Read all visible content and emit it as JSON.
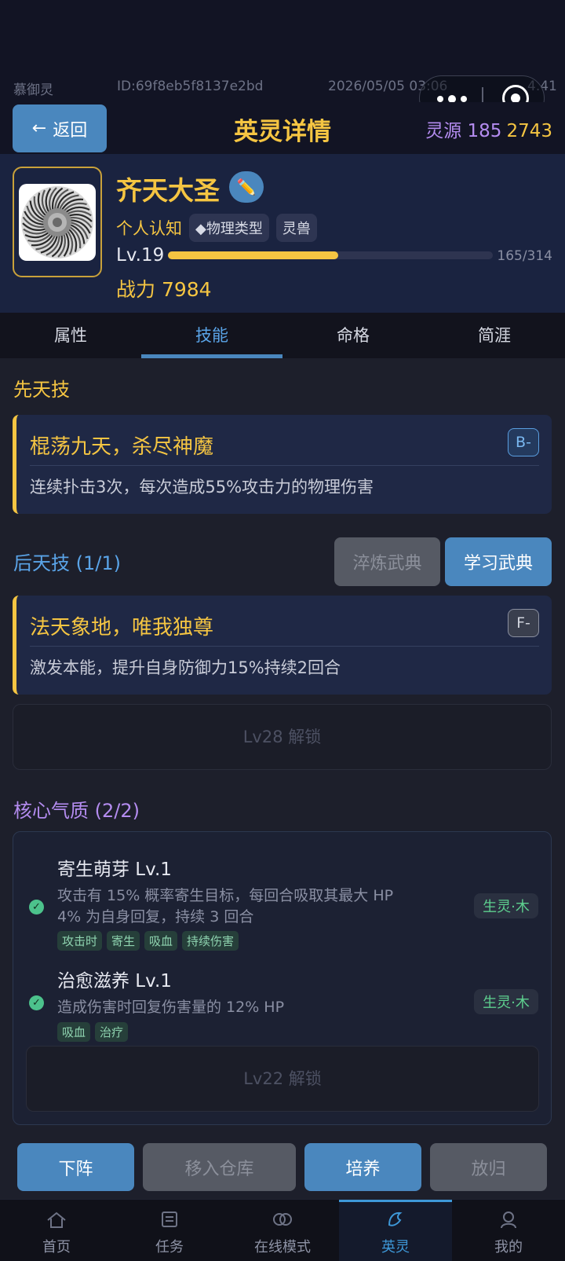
{
  "status": {
    "app_name": "慕御灵",
    "id_text": "ID:69f8eb5f8137e2bd",
    "datetime": "2026/05/05 03:06",
    "extra": "4.41"
  },
  "header": {
    "back_label": "返回",
    "title": "英灵详情",
    "currency_label": "灵源 185",
    "gold": "2743"
  },
  "hero": {
    "name": "齐天大圣",
    "tag_plain": "个人认知",
    "tag_type": "◆物理类型",
    "tag_class": "灵兽",
    "level": "Lv.19",
    "exp_text": "165/314",
    "exp_fraction": 0.525,
    "power": "战力 7984"
  },
  "tabs": [
    "属性",
    "技能",
    "命格",
    "简涯"
  ],
  "innate": {
    "title": "先天技",
    "skill_name": "棍荡九天，杀尽神魔",
    "grade": "B-",
    "desc": "连续扑击3次，每次造成55%攻击力的物理伤害"
  },
  "acquired": {
    "title": "后天技 (1/1)",
    "refine_btn": "淬炼武典",
    "learn_btn": "学习武典",
    "skill_name": "法天象地，唯我独尊",
    "grade": "F-",
    "desc": "激发本能，提升自身防御力15%持续2回合",
    "locked": "Lv28 解锁"
  },
  "core": {
    "title": "核心气质 (2/2)",
    "traits": [
      {
        "name": "寄生萌芽 Lv.1",
        "desc": "攻击有 15% 概率寄生目标，每回合吸取其最大 HP 4% 为自身回复，持续 3 回合",
        "tags": [
          "攻击时",
          "寄生",
          "吸血",
          "持续伤害"
        ],
        "element": "生灵·木"
      },
      {
        "name": "治愈滋养 Lv.1",
        "desc": "造成伤害时回复伤害量的 12% HP",
        "tags": [
          "吸血",
          "治疗"
        ],
        "element": "生灵·木"
      }
    ],
    "locked": "Lv22 解锁"
  },
  "actions": {
    "deploy": "下阵",
    "storage": "移入仓库",
    "train": "培养",
    "release": "放归"
  },
  "nav": [
    "首页",
    "任务",
    "在线模式",
    "英灵",
    "我的"
  ],
  "colors": {
    "gold": "#f5c542",
    "blue": "#4a87be",
    "purple": "#b48cf0",
    "green": "#5dcf8e"
  }
}
